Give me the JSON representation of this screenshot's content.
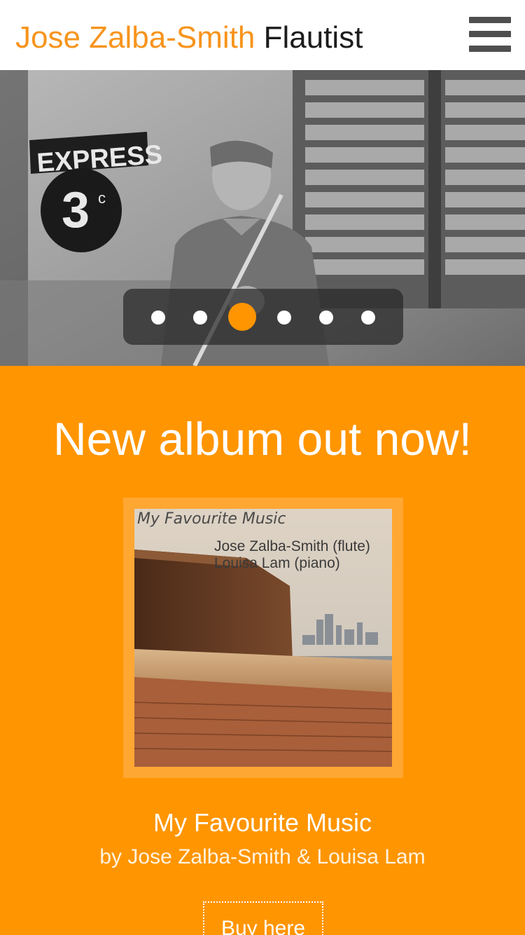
{
  "header": {
    "name": "Jose Zalba-Smith",
    "role": "Flautist",
    "menu_icon": "hamburger-menu-icon"
  },
  "hero": {
    "sign_line1": "EXPRESS",
    "sign_line2": "3",
    "sign_sup": "c",
    "carousel": {
      "count": 6,
      "active_index": 2
    }
  },
  "album_section": {
    "heading": "New album out now!",
    "cover_title": "My Favourite Music",
    "cover_credit_1": "Jose Zalba-Smith (flute)",
    "cover_credit_2": "Louisa Lam (piano)",
    "title": "My Favourite Music",
    "artists": "by Jose Zalba-Smith & Louisa Lam",
    "buy_label": "Buy here"
  },
  "colors": {
    "accent": "#ff9500",
    "name_orange": "#f7941d",
    "frame": "#ffa733"
  }
}
